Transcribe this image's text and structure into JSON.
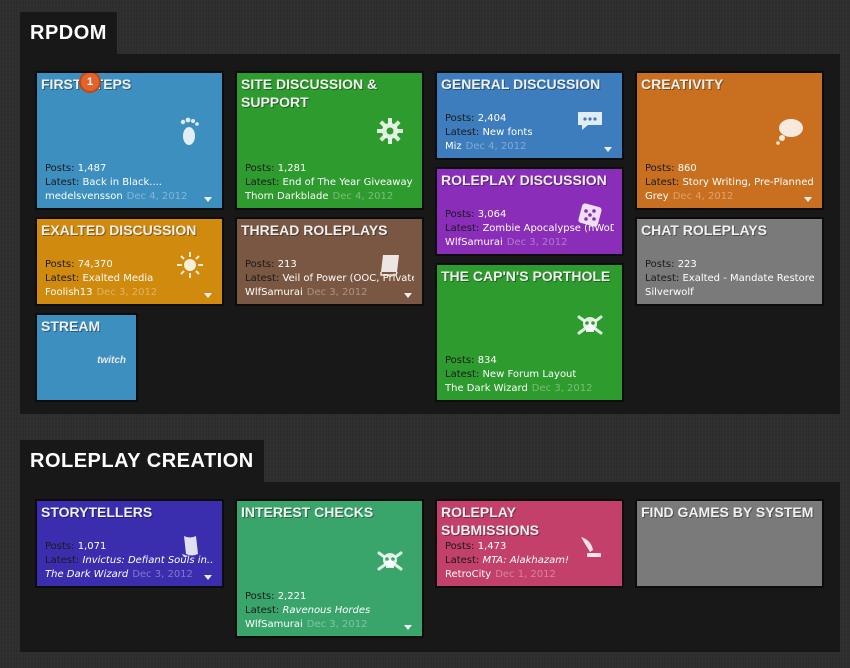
{
  "sections": [
    {
      "title": "RPDOM",
      "tiles": [
        {
          "title": "First Steps",
          "badge": "1",
          "posts_label": "Posts: ",
          "posts": "1,487",
          "latest_label": "Latest: ",
          "latest": "Back in Black....",
          "author": "medelsvensson",
          "date": "Dec 4, 2012",
          "color": "#3d8fc0",
          "icon": "footprint-icon"
        },
        {
          "title": "Site Discussion & Support",
          "posts_label": "Posts: ",
          "posts": "1,281",
          "latest_label": "Latest: ",
          "latest": "End of The Year Giveaway!",
          "author": "Thorn Darkblade",
          "date": "Dec 4, 2012",
          "color": "#2e9b2e",
          "icon": "gear-icon"
        },
        {
          "title": "General Discussion",
          "posts_label": "Posts: ",
          "posts": "2,404",
          "latest_label": "Latest: ",
          "latest": "New fonts",
          "author": "Miz",
          "date": "Dec 4, 2012",
          "color": "#3d7dbe",
          "icon": "speech-bubble-icon"
        },
        {
          "title": "Creativity",
          "posts_label": "Posts: ",
          "posts": "860",
          "latest_label": "Latest: ",
          "latest": "Story Writing, Pre-Planned",
          "author": "Grey",
          "date": "Dec 4, 2012",
          "color": "#c8701f",
          "icon": "thought-bubble-icon"
        },
        {
          "title": "Roleplay Discussion",
          "posts_label": "Posts: ",
          "posts": "3,064",
          "latest_label": "Latest: ",
          "latest": "Zombie Apocalypse (nWoD)",
          "author": "WlfSamurai",
          "date": "Dec 3, 2012",
          "color": "#8a2db8",
          "icon": "dice-icon"
        },
        {
          "title": "Exalted Discussion",
          "posts_label": "Posts: ",
          "posts": "74,370",
          "latest_label": "Latest: ",
          "latest": "Exalted Media",
          "author": "Foolish13",
          "date": "Dec 3, 2012",
          "color": "#d08a0d",
          "icon": "sun-icon"
        },
        {
          "title": "Thread Roleplays",
          "posts_label": "Posts: ",
          "posts": "213",
          "latest_label": "Latest: ",
          "latest": "Veil of Power (OOC, Private)",
          "author": "WlfSamurai",
          "date": "Dec 3, 2012",
          "color": "#7a5742",
          "icon": "book-icon"
        },
        {
          "title": "Chat Roleplays",
          "posts_label": "Posts: ",
          "posts": "223",
          "latest_label": "Latest: ",
          "latest": "Exalted - Mandate Restored",
          "author": "Silverwolf",
          "date": "",
          "color": "#7a7a7a",
          "icon": ""
        },
        {
          "title": "The Cap'n's Porthole",
          "posts_label": "Posts: ",
          "posts": "834",
          "latest_label": "Latest: ",
          "latest": "New Forum Layout",
          "author": "The Dark Wizard",
          "date": "Dec 3, 2012",
          "color": "#2e9b2e",
          "icon": "skull-crossbones-icon"
        },
        {
          "title": "Stream",
          "logo_text": "twitch",
          "color": "#3d8fc0",
          "icon": ""
        }
      ]
    },
    {
      "title": "ROLEPLAY CREATION",
      "tiles": [
        {
          "title": "Storytellers",
          "posts_label": "Posts: ",
          "posts": "1,071",
          "latest_label": "Latest: ",
          "latest": "Invictus: Defiant Souls in...",
          "author": "The Dark Wizard",
          "date": "Dec 3, 2012",
          "color": "#3a2eae",
          "icon": "scroll-icon"
        },
        {
          "title": "Interest Checks",
          "posts_label": "Posts: ",
          "posts": "2,221",
          "latest_label": "Latest: ",
          "latest": "Ravenous Hordes",
          "author": "WlfSamurai",
          "date": "Dec 3, 2012",
          "color": "#3aa56b",
          "icon": "skull-crossbones-icon"
        },
        {
          "title": "Roleplay Submissions",
          "posts_label": "Posts: ",
          "posts": "1,473",
          "latest_label": "Latest: ",
          "latest": "MTA: Alakhazam!",
          "author": "RetroCity",
          "date": "Dec 1, 2012",
          "color": "#c2406a",
          "icon": "quill-icon"
        },
        {
          "title": "Find Games By System",
          "color": "#7a7a7a",
          "icon": ""
        }
      ]
    }
  ]
}
